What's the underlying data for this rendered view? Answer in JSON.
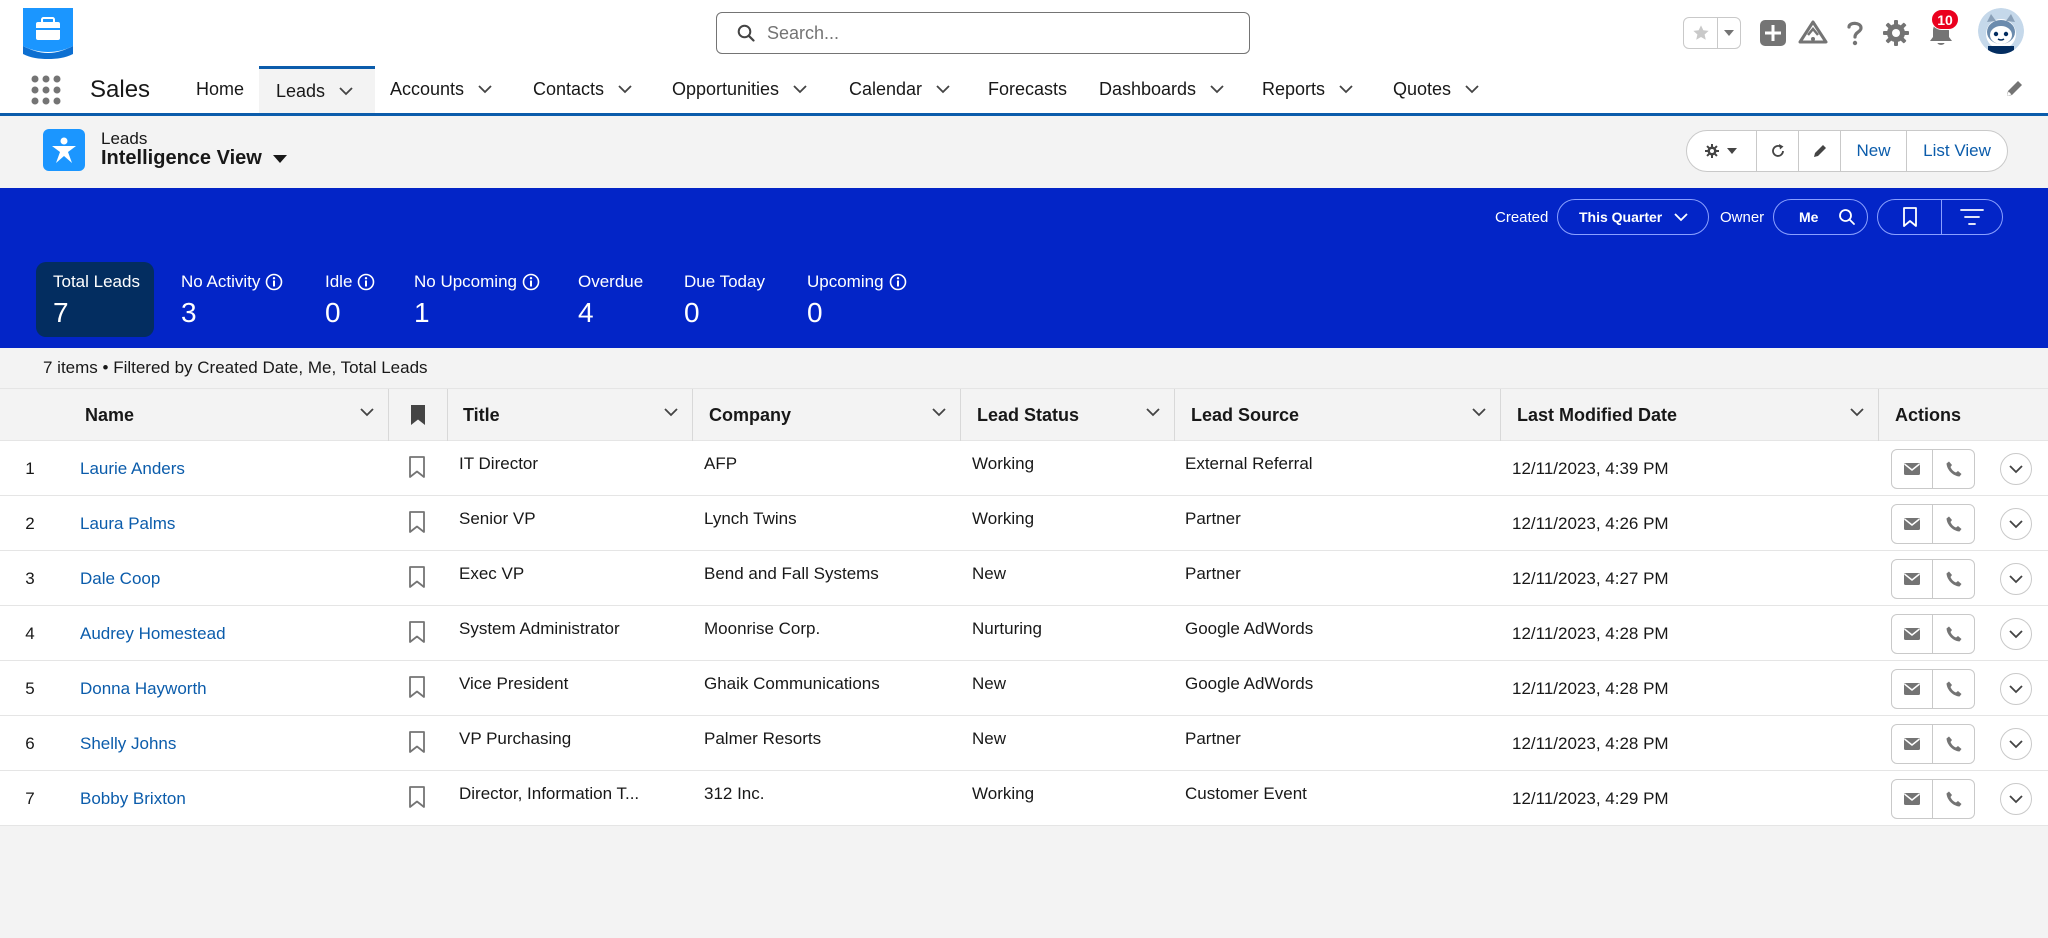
{
  "header": {
    "search_placeholder": "Search...",
    "notification_count": "10"
  },
  "nav": {
    "app_name": "Sales",
    "items": [
      {
        "label": "Home",
        "has_menu": false
      },
      {
        "label": "Leads",
        "has_menu": true
      },
      {
        "label": "Accounts",
        "has_menu": true
      },
      {
        "label": "Contacts",
        "has_menu": true
      },
      {
        "label": "Opportunities",
        "has_menu": true
      },
      {
        "label": "Calendar",
        "has_menu": true
      },
      {
        "label": "Forecasts",
        "has_menu": false
      },
      {
        "label": "Dashboards",
        "has_menu": true
      },
      {
        "label": "Reports",
        "has_menu": true
      },
      {
        "label": "Quotes",
        "has_menu": true
      }
    ],
    "active": "Leads"
  },
  "list_header": {
    "object_label": "Leads",
    "view_name": "Intelligence View",
    "new_label": "New",
    "list_view_label": "List View"
  },
  "intel": {
    "created_label": "Created",
    "created_value": "This Quarter",
    "owner_label": "Owner",
    "owner_value": "Me",
    "metrics": [
      {
        "label": "Total Leads",
        "value": "7",
        "info": false
      },
      {
        "label": "No Activity",
        "value": "3",
        "info": true
      },
      {
        "label": "Idle",
        "value": "0",
        "info": true
      },
      {
        "label": "No Upcoming",
        "value": "1",
        "info": true
      },
      {
        "label": "Overdue",
        "value": "4",
        "info": false
      },
      {
        "label": "Due Today",
        "value": "0",
        "info": false
      },
      {
        "label": "Upcoming",
        "value": "0",
        "info": true
      }
    ]
  },
  "status_line": "7 items • Filtered by Created Date, Me, Total Leads",
  "table": {
    "columns": [
      "Name",
      "Title",
      "Company",
      "Lead Status",
      "Lead Source",
      "Last Modified Date",
      "Actions"
    ],
    "rows": [
      {
        "num": "1",
        "name": "Laurie Anders",
        "title": "IT Director",
        "company": "AFP",
        "status": "Working",
        "source": "External Referral",
        "modified": "12/11/2023, 4:39 PM"
      },
      {
        "num": "2",
        "name": "Laura Palms",
        "title": "Senior VP",
        "company": "Lynch Twins",
        "status": "Working",
        "source": "Partner",
        "modified": "12/11/2023, 4:26 PM"
      },
      {
        "num": "3",
        "name": "Dale Coop",
        "title": "Exec VP",
        "company": "Bend and Fall Systems",
        "status": "New",
        "source": "Partner",
        "modified": "12/11/2023, 4:27 PM"
      },
      {
        "num": "4",
        "name": "Audrey Homestead",
        "title": "System Administrator",
        "company": "Moonrise Corp.",
        "status": "Nurturing",
        "source": "Google AdWords",
        "modified": "12/11/2023, 4:28 PM"
      },
      {
        "num": "5",
        "name": "Donna Hayworth",
        "title": "Vice President",
        "company": "Ghaik Communications",
        "status": "New",
        "source": "Google AdWords",
        "modified": "12/11/2023, 4:28 PM"
      },
      {
        "num": "6",
        "name": "Shelly Johns",
        "title": "VP Purchasing",
        "company": "Palmer Resorts",
        "status": "New",
        "source": "Partner",
        "modified": "12/11/2023, 4:28 PM"
      },
      {
        "num": "7",
        "name": "Bobby Brixton",
        "title": "Director, Information T...",
        "company": "312 Inc.",
        "status": "Working",
        "source": "Customer Event",
        "modified": "12/11/2023, 4:29 PM"
      }
    ]
  },
  "colors": {
    "brand_blue": "#0b5cab",
    "intel_band": "#0325c7",
    "selected_metric": "#032d60",
    "object_icon": "#1b96ff",
    "badge_red": "#ea001e"
  }
}
